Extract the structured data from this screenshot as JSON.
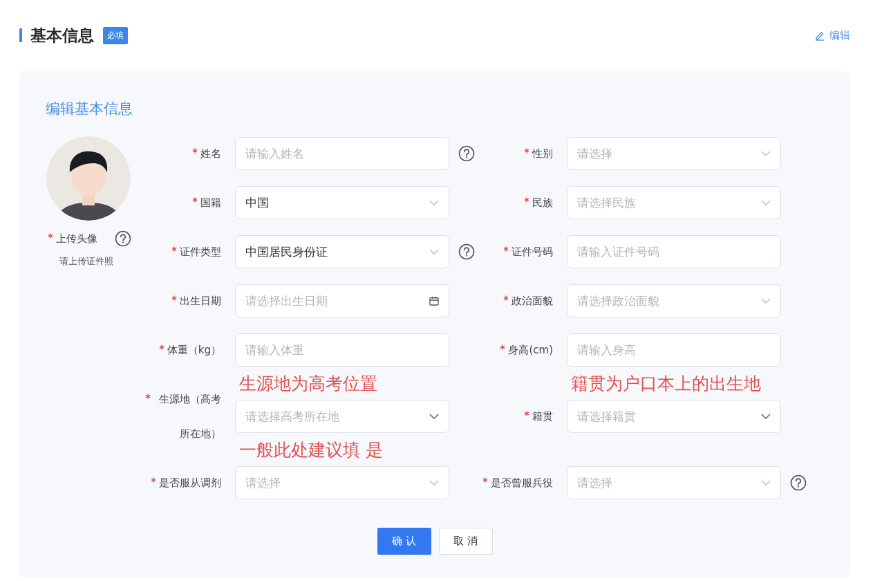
{
  "header": {
    "title": "基本信息",
    "badge": "必填",
    "edit_link": "编辑"
  },
  "card": {
    "title": "编辑基本信息",
    "avatar": {
      "label": "上传头像",
      "required": true,
      "help": true,
      "hint": "请上传证件照"
    },
    "rows": [
      [
        {
          "label": "姓名",
          "required": true,
          "kind": "text",
          "placeholder": "请输入姓名",
          "help": true
        },
        {
          "label": "性别",
          "required": true,
          "kind": "select",
          "placeholder": "请选择",
          "help": false
        }
      ],
      [
        {
          "label": "国籍",
          "required": true,
          "kind": "select",
          "value": "中国",
          "help": false
        },
        {
          "label": "民族",
          "required": true,
          "kind": "select",
          "placeholder": "请选择民族",
          "help": false
        }
      ],
      [
        {
          "label": "证件类型",
          "required": true,
          "kind": "select",
          "value": "中国居民身份证",
          "help": true
        },
        {
          "label": "证件号码",
          "required": true,
          "kind": "text",
          "placeholder": "请输入证件号码",
          "help": false
        }
      ],
      [
        {
          "label": "出生日期",
          "required": true,
          "kind": "date",
          "placeholder": "请选择出生日期",
          "help": false
        },
        {
          "label": "政治面貌",
          "required": true,
          "kind": "select",
          "placeholder": "请选择政治面貌",
          "help": false
        }
      ],
      [
        {
          "label": "体重（kg）",
          "required": true,
          "kind": "text",
          "placeholder": "请输入体重",
          "help": false
        },
        {
          "label": "身高(cm)",
          "required": true,
          "kind": "text",
          "placeholder": "请输入身高",
          "help": false
        }
      ],
      [
        {
          "label": "生源地（高考所在地）",
          "required": true,
          "kind": "select",
          "placeholder": "请选择高考所在地",
          "help": false,
          "annotation": "生源地为高考位置"
        },
        {
          "label": "籍贯",
          "required": true,
          "kind": "select",
          "placeholder": "请选择籍贯",
          "help": false,
          "annotation": "籍贯为户口本上的出生地"
        }
      ],
      [
        {
          "label": "是否服从调剂",
          "required": true,
          "kind": "select",
          "placeholder": "请选择",
          "help": false,
          "annotation": "一般此处建议填 是"
        },
        {
          "label": "是否曾服兵役",
          "required": true,
          "kind": "select",
          "placeholder": "请选择",
          "help": true
        }
      ]
    ],
    "buttons": [
      {
        "label": "确 认",
        "kind": "primary"
      },
      {
        "label": "取 消",
        "kind": "default"
      }
    ]
  }
}
